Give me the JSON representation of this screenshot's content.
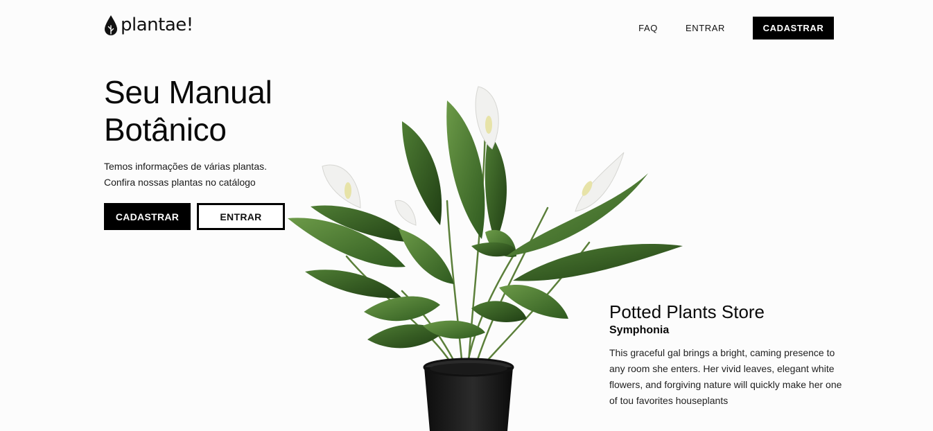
{
  "brand": {
    "name": "plantae!",
    "icon": "leaf-drop-icon"
  },
  "nav": {
    "faq": "FAQ",
    "login": "ENTRAR",
    "signup": "CADASTRAR"
  },
  "hero": {
    "title_line1": "Seu Manual",
    "title_line2": "Botânico",
    "desc_line1": "Temos informações de várias plantas.",
    "desc_line2": "Confira nossas plantas no catálogo",
    "primary_button": "CADASTRAR",
    "secondary_button": "ENTRAR"
  },
  "store": {
    "title": "Potted Plants Store",
    "subtitle": "Symphonia",
    "description": "This graceful gal brings a bright, caming presence to any room she enters. Her vivid leaves, elegant white flowers, and forgiving nature will quickly make her one of tou favorites houseplants"
  },
  "colors": {
    "background": "#fcfcfc",
    "primary": "#000000",
    "leaf": "#4a7a30",
    "pot": "#151515"
  }
}
